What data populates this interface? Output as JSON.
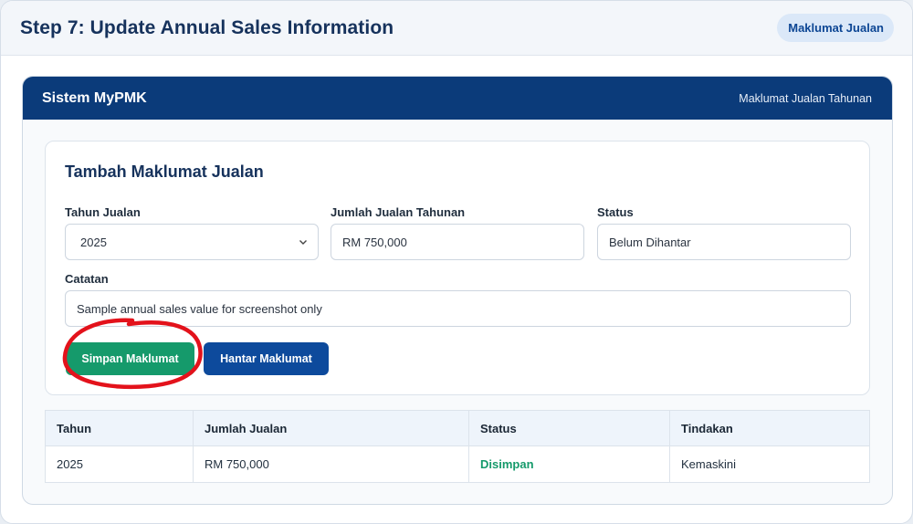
{
  "step": {
    "title": "Step 7: Update Annual Sales Information",
    "badge": "Maklumat Jualan"
  },
  "app": {
    "name": "Sistem MyPMK",
    "section": "Maklumat Jualan Tahunan"
  },
  "form": {
    "title": "Tambah Maklumat Jualan",
    "year": {
      "label": "Tahun Jualan",
      "value": "2025"
    },
    "amount": {
      "label": "Jumlah Jualan Tahunan",
      "value": "RM 750,000"
    },
    "status": {
      "label": "Status",
      "value": "Belum Dihantar"
    },
    "notes": {
      "label": "Catatan",
      "value": "Sample annual sales value for screenshot only"
    },
    "save_label": "Simpan Maklumat",
    "submit_label": "Hantar Maklumat"
  },
  "annotation": {
    "color": "#e3121b"
  },
  "table": {
    "headers": [
      "Tahun",
      "Jumlah Jualan",
      "Status",
      "Tindakan"
    ],
    "rows": [
      {
        "year": "2025",
        "amount": "RM 750,000",
        "status": "Disimpan",
        "action": "Kemaskini"
      }
    ]
  },
  "colors": {
    "primary": "#0b3b7a",
    "save": "#159a6b",
    "submit": "#0d4a9c"
  }
}
